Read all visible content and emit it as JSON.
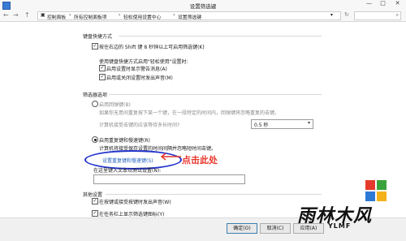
{
  "window": {
    "title": "设置筛选键"
  },
  "nav": {
    "back_glyph": "←",
    "forward_glyph": "→",
    "up_glyph": "↑",
    "breadcrumb": [
      "控制面板",
      "所有控制面板项",
      "轻松使用设置中心",
      "设置筛选键"
    ]
  },
  "keyboard_shortcut": {
    "heading": "键盘快捷方式",
    "enable_checkbox": {
      "checked": true,
      "label": "按住右边的 Shift 键 8 秒钟以上可启用筛选键(K)"
    },
    "when_using_label": "使用键盘快捷方式启用\"轻松使用\"设置时:",
    "options": [
      {
        "checked": true,
        "label": "启用设置时显示警告消息(A)"
      },
      {
        "checked": true,
        "label": "启用或关闭设置时发出声音(M)"
      }
    ]
  },
  "filter_options": {
    "heading": "筛选器选项",
    "bounce_keys": {
      "radio_label": "启用回弹键(B)",
      "description": "如果你无意间重复按下某一个键，在一段特定的时间内，回弹键将忽略重复的击键。",
      "wait_label": "计算机接受击键的应该等待多长时间?",
      "wait_value": "0.5 秒"
    },
    "repeat_keys": {
      "radio_label": "启用重复键和慢速键(R)",
      "description": "计算机将接受保存设置的时间间隔并忽略短时间击键。",
      "setup_link": "设置重复键和慢速键(S)"
    },
    "test_label": "在这里键入文本以测试设置(N):",
    "test_value": ""
  },
  "other_settings": {
    "heading": "其他设置",
    "options": [
      {
        "checked": true,
        "label": "在按键或接受按键时发出声音(W)"
      },
      {
        "checked": true,
        "label": "在任务栏上显示筛选键图标(Y)"
      }
    ]
  },
  "footer": {
    "ok": "确定(O)",
    "cancel": "取消(C)",
    "apply": "应用(A)"
  },
  "annotation": {
    "callout": "点击此处"
  },
  "watermark": {
    "text": "雨林木风",
    "sub": "YLMF"
  },
  "colors": {
    "link": "#1f5fbf",
    "callout": "#e8352a",
    "circle": "#2233cc"
  }
}
